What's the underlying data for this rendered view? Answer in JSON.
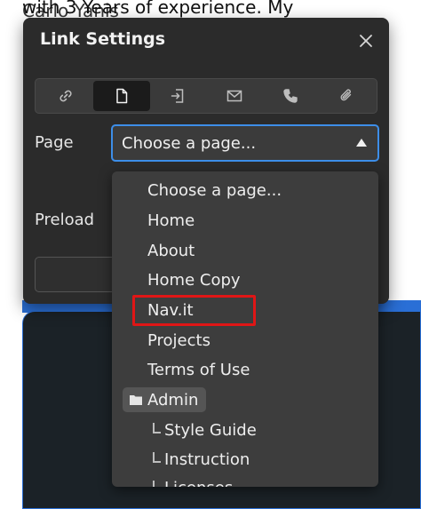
{
  "background": {
    "text_behind": "with 3 Years of experience. My",
    "text_overlay": "Carlo Yanis"
  },
  "modal": {
    "title": "Link Settings",
    "tabs": [
      {
        "icon": "link-icon",
        "active": false
      },
      {
        "icon": "page-icon",
        "active": true
      },
      {
        "icon": "section-icon",
        "active": false
      },
      {
        "icon": "email-icon",
        "active": false
      },
      {
        "icon": "phone-icon",
        "active": false
      },
      {
        "icon": "attachment-icon",
        "active": false
      }
    ],
    "page_label": "Page",
    "preload_label": "Preload",
    "select_value": "Choose a page..."
  },
  "dropdown": {
    "options": [
      "Choose a page...",
      "Home",
      "About",
      "Home Copy",
      "Nav.it",
      "Projects",
      "Terms of Use"
    ],
    "folder": "Admin",
    "sub_options": [
      "Style Guide",
      "Instruction",
      "Licenses"
    ]
  },
  "colors": {
    "accent": "#3d8ee8",
    "highlight": "#e01616"
  }
}
